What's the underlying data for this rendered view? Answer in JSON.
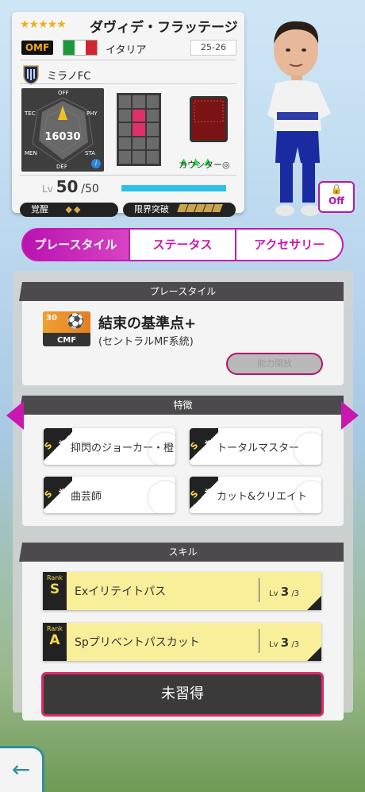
{
  "player": {
    "stars": "★★★★★",
    "name": "ダヴィデ・フラッテージ",
    "position": "OMF",
    "country": "イタリア",
    "season": "25-26",
    "club": "ミラノFC",
    "radar": {
      "total": "16030",
      "top": "OFF",
      "top_right": "PHY",
      "right": "STA",
      "bottom": "DEF",
      "left": "MEN",
      "top_left": "TEC"
    },
    "play_type": "カウンター◎",
    "level_prefix": "Lv",
    "level": "50",
    "level_max": "/50",
    "awakening_label": "覚醒",
    "awakening_value": "◆◆",
    "limit_break_label": "限界突破",
    "limit_break_count": 5,
    "flag_colors": [
      "#1a9a3a",
      "#ffffff",
      "#d3262e"
    ]
  },
  "avatar_toggle": {
    "lock_icon": "lock-icon",
    "label": "Off"
  },
  "tabs": [
    {
      "label": "プレースタイル",
      "active": true
    },
    {
      "label": "ステータス",
      "active": false
    },
    {
      "label": "アクセサリー",
      "active": false
    }
  ],
  "playstyle": {
    "header": "プレースタイル",
    "level": "30",
    "position": "CMF",
    "title": "結束の基準点+",
    "subtitle": "(セントラルMF系統)",
    "button_label": "能力開放"
  },
  "traits": {
    "header": "特徴",
    "items": [
      {
        "rank_label": "Rank",
        "rank": "S",
        "name": "抑閃のジョーカー・橙"
      },
      {
        "rank_label": "Rank",
        "rank": "S",
        "name": "トータルマスター"
      },
      {
        "rank_label": "Rank",
        "rank": "S",
        "name": "曲芸師"
      },
      {
        "rank_label": "Rank",
        "rank": "S",
        "name": "カット&クリエイト"
      }
    ]
  },
  "skills": {
    "header": "スキル",
    "items": [
      {
        "rank_label": "Rank",
        "rank": "S",
        "name": "Exイリテイトパス",
        "lv_label": "Lv",
        "lv": "3",
        "lv_max": "/3"
      },
      {
        "rank_label": "Rank",
        "rank": "A",
        "name": "Spプリベントパスカット",
        "lv_label": "Lv",
        "lv": "3",
        "lv_max": "/3"
      }
    ],
    "unlearned_label": "未習得"
  },
  "back_button": "←",
  "colors": {
    "accent": "#c818b0",
    "level_bar": "#2ec0e8",
    "skill_bg": "#f9ef9a",
    "back": "#2e8e9e"
  }
}
